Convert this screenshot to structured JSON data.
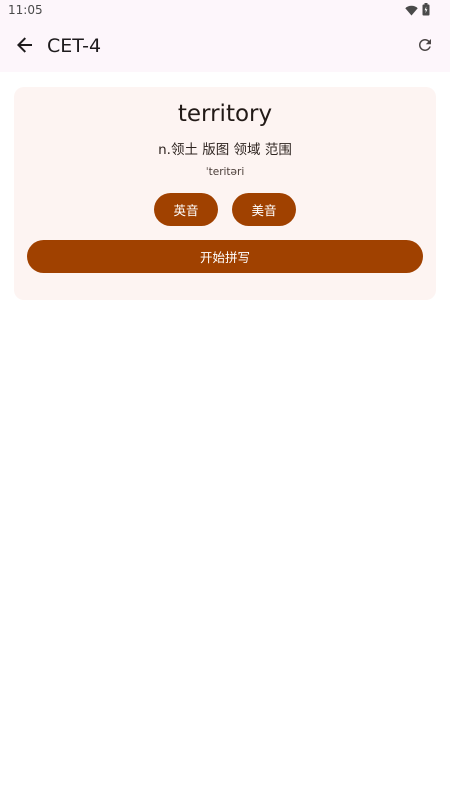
{
  "status_bar": {
    "time": "11:05",
    "icons": [
      "wifi-icon",
      "battery-icon"
    ]
  },
  "app_bar": {
    "back_icon": "arrow-left-icon",
    "title": "CET-4",
    "refresh_icon": "refresh-icon"
  },
  "word_card": {
    "word": "territory",
    "meaning": "n.领土 版图 领域 范围",
    "phonetic": "ˈteritəri",
    "uk_button_label": "英音",
    "us_button_label": "美音",
    "spell_button_label": "开始拼写"
  },
  "colors": {
    "accent": "#a04100",
    "card_background": "#fdf4f2",
    "bar_background": "#fdf6fb"
  }
}
